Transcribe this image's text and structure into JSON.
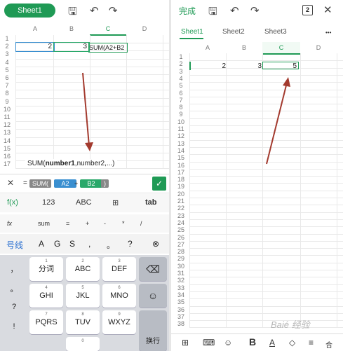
{
  "left": {
    "toolbar": {
      "sheet_label": "Sheet1",
      "save_icon": "save-icon",
      "undo_icon": "undo-icon",
      "redo_icon": "redo-icon"
    },
    "columns": [
      "A",
      "B",
      "C",
      "D"
    ],
    "rows": [
      "1",
      "2",
      "3",
      "4",
      "5",
      "6",
      "7",
      "8",
      "9",
      "10",
      "11",
      "12",
      "13",
      "14",
      "15",
      "16",
      "17"
    ],
    "cells": {
      "a2": "2",
      "b2": "3",
      "c2": "SUM(A2+B2"
    },
    "hint": {
      "prefix": "SUM(",
      "bold": "number1",
      "suffix": ",number2,...)"
    },
    "formula": {
      "close": "✕",
      "equals": "=",
      "fn": "SUM(",
      "ref1": "A2",
      "plus": "+",
      "ref2": "B2",
      "paren": ")",
      "confirm": "✓"
    },
    "input_tabs": [
      "f(x)",
      "123",
      "ABC",
      "⊞",
      "tab"
    ],
    "functions": [
      "fx",
      "sum",
      "=",
      "+",
      "-",
      "*",
      "/"
    ],
    "candidates": [
      "号线",
      "A",
      "G",
      "S",
      ",",
      "。",
      "?",
      "⊗"
    ],
    "left_column": [
      "，",
      "。",
      "?",
      "!"
    ],
    "keys": [
      {
        "num": "1",
        "label": "分词"
      },
      {
        "num": "2",
        "label": "ABC"
      },
      {
        "num": "3",
        "label": "DEF"
      },
      {
        "num": "4",
        "label": "GHI"
      },
      {
        "num": "5",
        "label": "JKL"
      },
      {
        "num": "6",
        "label": "MNO"
      },
      {
        "num": "7",
        "label": "PQRS"
      },
      {
        "num": "8",
        "label": "TUV"
      },
      {
        "num": "9",
        "label": "WXYZ"
      }
    ],
    "backspace": "⌫",
    "emoji": "☺",
    "enter": "换行",
    "zero": "0"
  },
  "right": {
    "toolbar": {
      "done": "完成",
      "count": "2",
      "close": "✕"
    },
    "tabs": [
      "Sheet1",
      "Sheet2",
      "Sheet3"
    ],
    "more": "•••",
    "columns": [
      "A",
      "B",
      "C",
      "D"
    ],
    "rows": [
      "1",
      "2",
      "3",
      "4",
      "5",
      "6",
      "7",
      "8",
      "9",
      "10",
      "11",
      "12",
      "13",
      "14",
      "15",
      "16",
      "17",
      "18",
      "19",
      "20",
      "21",
      "22",
      "23",
      "24",
      "25",
      "26",
      "27",
      "28",
      "29",
      "30",
      "31",
      "32",
      "33",
      "34",
      "35",
      "36",
      "37",
      "38"
    ],
    "cells": {
      "a2": "2",
      "b2": "3",
      "c2": "5"
    },
    "bottom_icons": [
      "⊞",
      "⌨",
      "☺",
      "B",
      "A",
      "◇",
      "≡",
      "合"
    ],
    "bold_label": "B",
    "watermark": "Baié 经验"
  },
  "colors": {
    "accent": "#1f9a55",
    "arrow": "#a33a2e"
  }
}
